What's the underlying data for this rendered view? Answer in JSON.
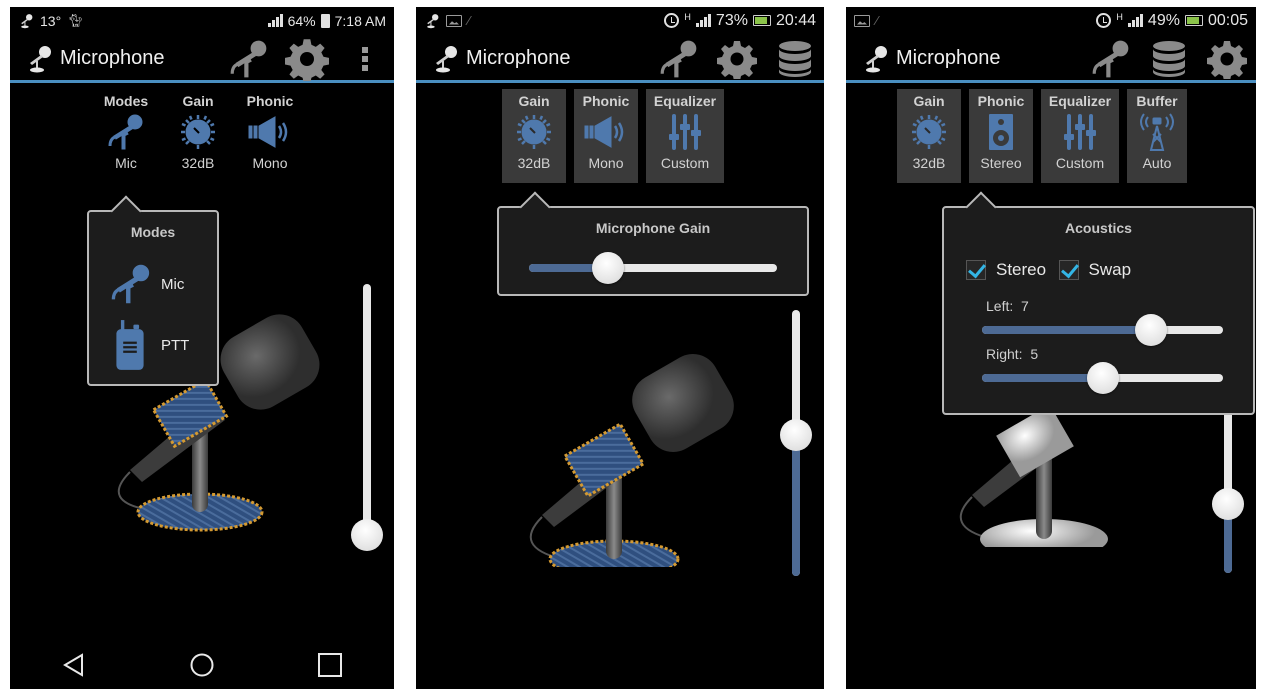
{
  "colors": {
    "accent": "#4a8fc1",
    "icon_blue": "#4f79ad",
    "slider_fill": "#4d6a94",
    "checkbox": "#33b5e5",
    "popup_bg": "#1c1c1c",
    "tab_bg": "#3a3a3a"
  },
  "screens": [
    {
      "status_bar": {
        "left_icons": [
          "microphone-notification-icon",
          "weather-icon",
          "cat-icon"
        ],
        "temperature": "13°",
        "battery_percent": "64%",
        "time": "7:18 AM"
      },
      "action_bar": {
        "title": "Microphone",
        "actions": [
          "microphone-icon",
          "settings-gear-icon",
          "overflow-menu-icon"
        ]
      },
      "tabs": [
        {
          "label": "Modes",
          "value": "Mic",
          "icon": "microphone-icon"
        },
        {
          "label": "Gain",
          "value": "32dB",
          "icon": "knob-icon"
        },
        {
          "label": "Phonic",
          "value": "Mono",
          "icon": "speaker-icon"
        }
      ],
      "popup": {
        "title": "Modes",
        "items": [
          {
            "label": "Mic",
            "icon": "microphone-icon"
          },
          {
            "label": "PTT",
            "icon": "walkie-talkie-icon"
          }
        ]
      },
      "volume_slider": {
        "value": 0.0
      },
      "nav": [
        "back",
        "home",
        "recents"
      ]
    },
    {
      "status_bar": {
        "left_icons": [
          "microphone-notification-icon",
          "image-icon",
          "pen-icon"
        ],
        "network": "H",
        "battery_percent": "73%",
        "time": "20:44"
      },
      "action_bar": {
        "title": "Microphone",
        "actions": [
          "microphone-icon",
          "settings-gear-icon",
          "database-icon"
        ]
      },
      "tabs": [
        {
          "label": "Gain",
          "value": "32dB",
          "icon": "knob-icon"
        },
        {
          "label": "Phonic",
          "value": "Mono",
          "icon": "speaker-icon"
        },
        {
          "label": "Equalizer",
          "value": "Custom",
          "icon": "equalizer-icon"
        }
      ],
      "popup": {
        "title": "Microphone Gain",
        "gain_slider": {
          "value": 0.32
        }
      },
      "volume_slider": {
        "value": 0.53
      }
    },
    {
      "status_bar": {
        "left_icons": [
          "image-icon",
          "pen-icon"
        ],
        "network": "H",
        "battery_percent": "49%",
        "time": "00:05"
      },
      "action_bar": {
        "title": "Microphone",
        "actions": [
          "microphone-icon",
          "database-icon",
          "settings-gear-icon"
        ]
      },
      "tabs": [
        {
          "label": "Gain",
          "value": "32dB",
          "icon": "knob-icon"
        },
        {
          "label": "Phonic",
          "value": "Stereo",
          "icon": "loudspeaker-box-icon"
        },
        {
          "label": "Equalizer",
          "value": "Custom",
          "icon": "equalizer-icon"
        },
        {
          "label": "Buffer",
          "value": "Auto",
          "icon": "radio-tower-icon"
        }
      ],
      "popup": {
        "title": "Acoustics",
        "checkboxes": [
          {
            "label": "Stereo",
            "checked": true
          },
          {
            "label": "Swap",
            "checked": true
          }
        ],
        "left": {
          "label": "Left:",
          "value": "7",
          "fraction": 0.7
        },
        "right": {
          "label": "Right:",
          "value": "5",
          "fraction": 0.5
        }
      },
      "volume_slider": {
        "value": 0.37
      }
    }
  ]
}
